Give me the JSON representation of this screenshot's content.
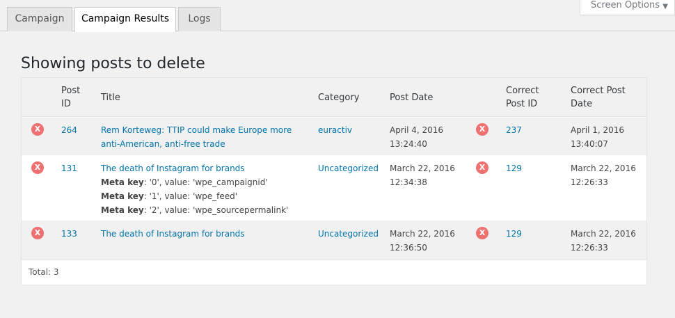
{
  "tabs": [
    {
      "label": "Campaign"
    },
    {
      "label": "Campaign Results"
    },
    {
      "label": "Logs"
    }
  ],
  "screen_options": {
    "label": "Screen Options"
  },
  "heading": "Showing posts to delete",
  "table": {
    "headers": {
      "post_id": [
        "Post",
        "ID"
      ],
      "title": "Title",
      "category": "Category",
      "post_date": "Post Date",
      "correct_post_id": [
        "Correct",
        "Post ID"
      ],
      "correct_post_date": [
        "Correct Post",
        "Date"
      ]
    },
    "rows": [
      {
        "post_id": "264",
        "title": [
          "Rem Korteweg: TTIP could make Europe more",
          "anti-American, anti-free trade"
        ],
        "meta": [],
        "category": "euractiv",
        "post_date": [
          "April 4, 2016",
          "13:24:40"
        ],
        "correct_post_id": "237",
        "correct_post_date": [
          "April 1, 2016",
          "13:40:07"
        ]
      },
      {
        "post_id": "131",
        "title": [
          "The death of Instagram for brands"
        ],
        "meta": [
          {
            "key": "Meta key",
            "rest": ": '0', value: 'wpe_campaignid'"
          },
          {
            "key": "Meta key",
            "rest": ": '1', value: 'wpe_feed'"
          },
          {
            "key": "Meta key",
            "rest": ": '2', value: 'wpe_sourcepermalink'"
          }
        ],
        "category": "Uncategorized",
        "post_date": [
          "March 22, 2016",
          "12:34:38"
        ],
        "correct_post_id": "129",
        "correct_post_date": [
          "March 22, 2016",
          "12:26:33"
        ]
      },
      {
        "post_id": "133",
        "title": [
          "The death of Instagram for brands"
        ],
        "meta": [],
        "category": "Uncategorized",
        "post_date": [
          "March 22, 2016",
          "12:36:50"
        ],
        "correct_post_id": "129",
        "correct_post_date": [
          "March 22, 2016",
          "12:26:33"
        ]
      }
    ],
    "delete_icon_glyph": "X",
    "total": "Total: 3"
  },
  "colors": {
    "link": "#0073aa",
    "delete_icon": "#ee7070",
    "background": "#f1f1f1"
  }
}
